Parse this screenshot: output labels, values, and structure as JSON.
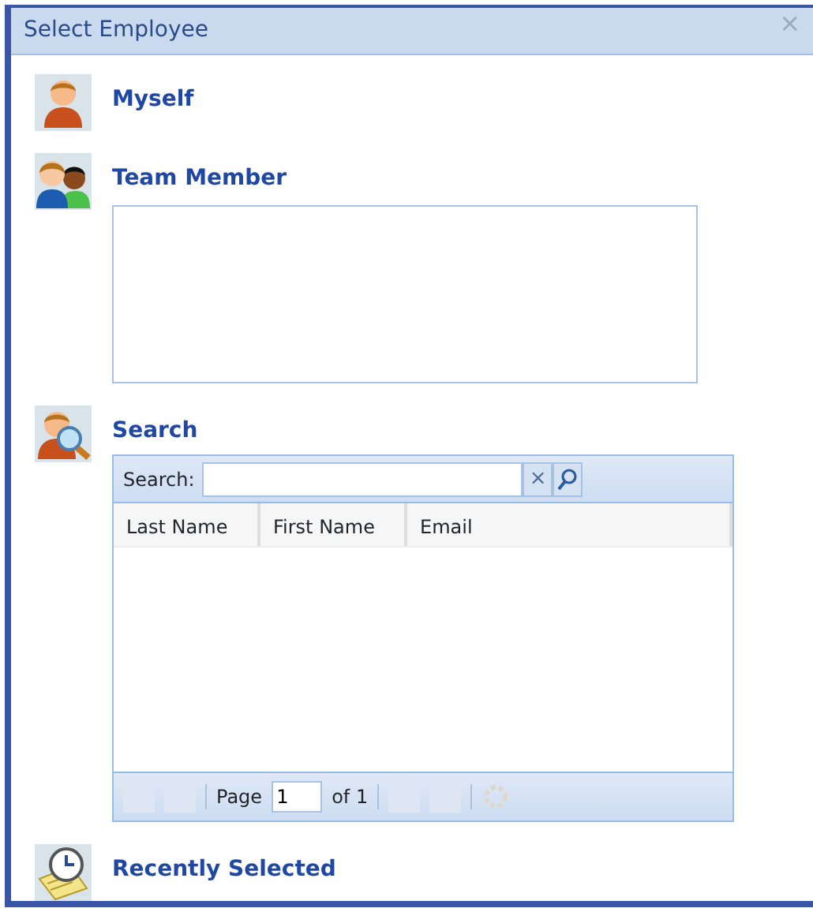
{
  "window": {
    "title": "Select Employee",
    "close": "×"
  },
  "sections": [
    {
      "kind": "myself",
      "label": "Myself"
    },
    {
      "kind": "team",
      "label": "Team Member"
    },
    {
      "kind": "search",
      "label": "Search"
    },
    {
      "kind": "recent",
      "label": "Recently Selected"
    }
  ],
  "search_grid": {
    "search_label": "Search:",
    "clear": "×",
    "columns": [
      "Last Name",
      "First Name",
      "Email"
    ],
    "pager": {
      "page_label": "Page",
      "page": "1",
      "of": "of 1",
      "buttons_before": [
        {
          "disabled": true
        },
        {
          "disabled": true
        }
      ],
      "buttons_after": [
        {
          "disabled": true
        },
        {
          "disabled": true
        }
      ],
      "refresh_disabled": true
    }
  }
}
